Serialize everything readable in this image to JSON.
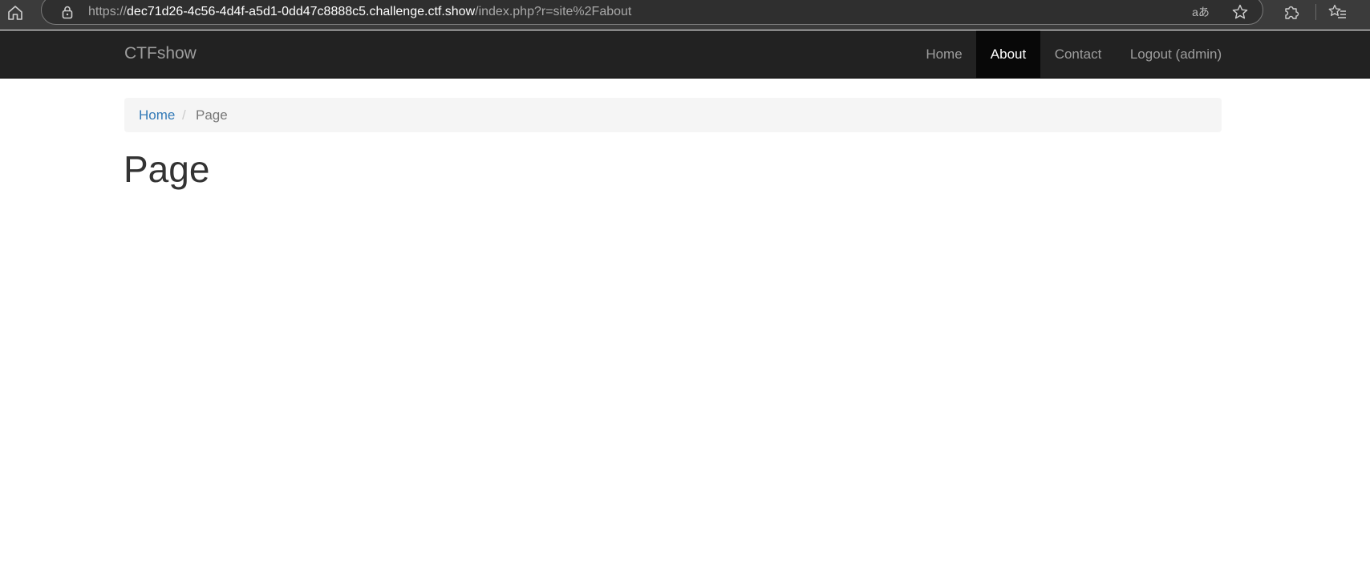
{
  "browser": {
    "url_scheme": "https://",
    "url_host": "dec71d26-4c56-4d4f-a5d1-0dd47c8888c5.challenge.ctf.show",
    "url_path": "/index.php?r=site%2Fabout",
    "translate_label": "aあ",
    "icons": [
      "home-icon",
      "lock-icon",
      "translate-icon",
      "star-icon",
      "extensions-icon",
      "favorites-icon"
    ]
  },
  "navbar": {
    "brand": "CTFshow",
    "items": [
      {
        "label": "Home",
        "active": false
      },
      {
        "label": "About",
        "active": true
      },
      {
        "label": "Contact",
        "active": false
      },
      {
        "label": "Logout (admin)",
        "active": false
      }
    ]
  },
  "breadcrumb": {
    "home": "Home",
    "separator": "/",
    "current": "Page"
  },
  "main": {
    "title": "Page"
  },
  "colors": {
    "navbar_bg": "#222222",
    "active_nav_bg": "#080808",
    "link": "#337ab7",
    "breadcrumb_bg": "#f5f5f5"
  }
}
